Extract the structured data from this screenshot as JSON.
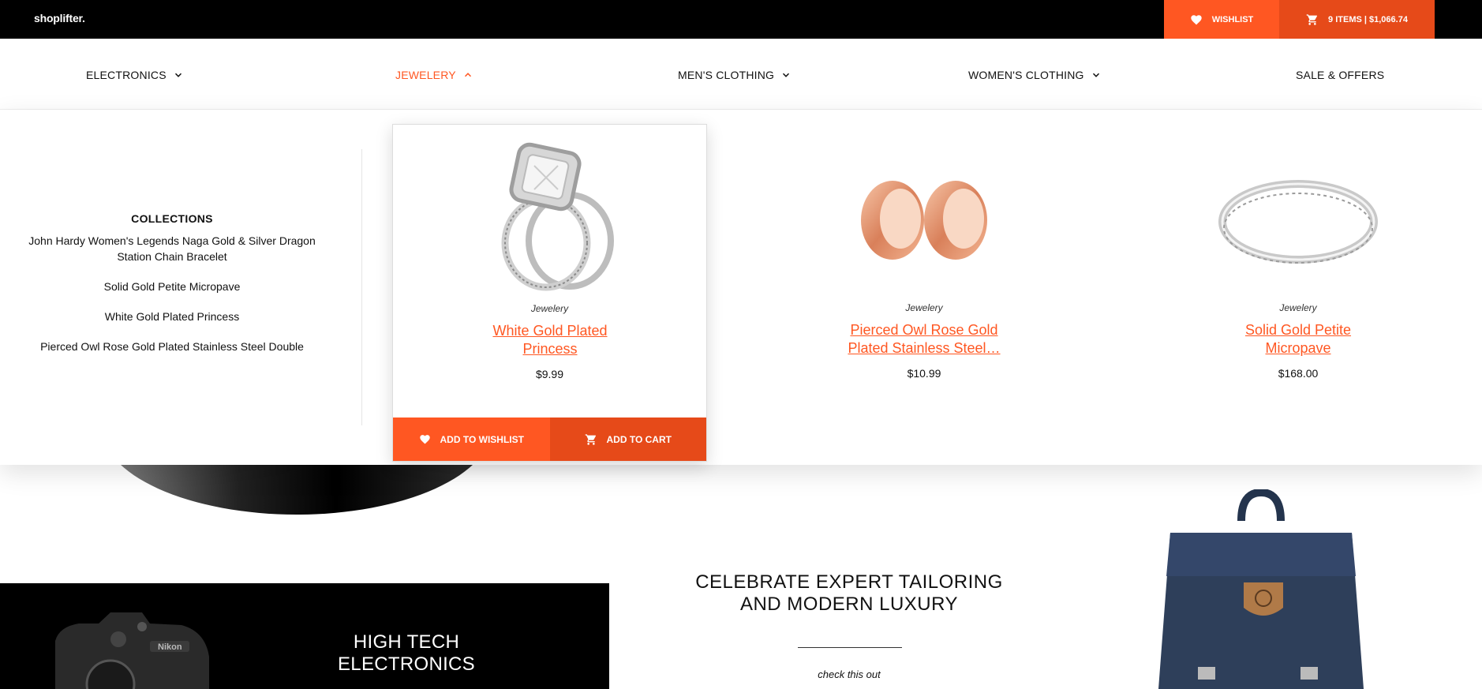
{
  "brand": {
    "logo": "shoplifter."
  },
  "top_bar": {
    "wishlist_label": "WISHLIST",
    "cart_label": "9 ITEMS | $1,066.74"
  },
  "nav": {
    "items": [
      {
        "label": "ELECTRONICS",
        "active": false,
        "has_dropdown": true
      },
      {
        "label": "JEWELERY",
        "active": true,
        "has_dropdown": true
      },
      {
        "label": "MEN'S CLOTHING",
        "active": false,
        "has_dropdown": true
      },
      {
        "label": "WOMEN'S CLOTHING",
        "active": false,
        "has_dropdown": true
      },
      {
        "label": "SALE & OFFERS",
        "active": false,
        "has_dropdown": false
      }
    ]
  },
  "mega_menu": {
    "collections_title": "COLLECTIONS",
    "collections": [
      "John Hardy Women's Legends Naga Gold & Silver Dragon Station Chain Bracelet",
      "Solid Gold Petite Micropave",
      "White Gold Plated Princess",
      "Pierced Owl Rose Gold Plated Stainless Steel Double"
    ],
    "products": [
      {
        "category": "Jewelery",
        "name": "White Gold Plated Princess",
        "price": "$9.99",
        "image_icon": "diamond-ring-image"
      },
      {
        "category": "Jewelery",
        "name": "Pierced Owl Rose Gold Plated Stainless Steel…",
        "price": "$10.99",
        "image_icon": "rose-gold-tunnels-image"
      },
      {
        "category": "Jewelery",
        "name": "Solid Gold Petite Micropave",
        "price": "$168.00",
        "image_icon": "silver-band-ring-image"
      }
    ],
    "card_actions": {
      "wishlist": "ADD TO WISHLIST",
      "cart": "ADD TO CART"
    }
  },
  "below_banner": {
    "electronics_title": "HIGH TECH ELECTRONICS",
    "tailoring_heading": "CELEBRATE EXPERT TAILORING AND MODERN LUXURY",
    "tailoring_link": "check this out"
  },
  "colors": {
    "accent": "#ff5722",
    "accent_dark": "#e64a19",
    "topbar": "#000000"
  }
}
